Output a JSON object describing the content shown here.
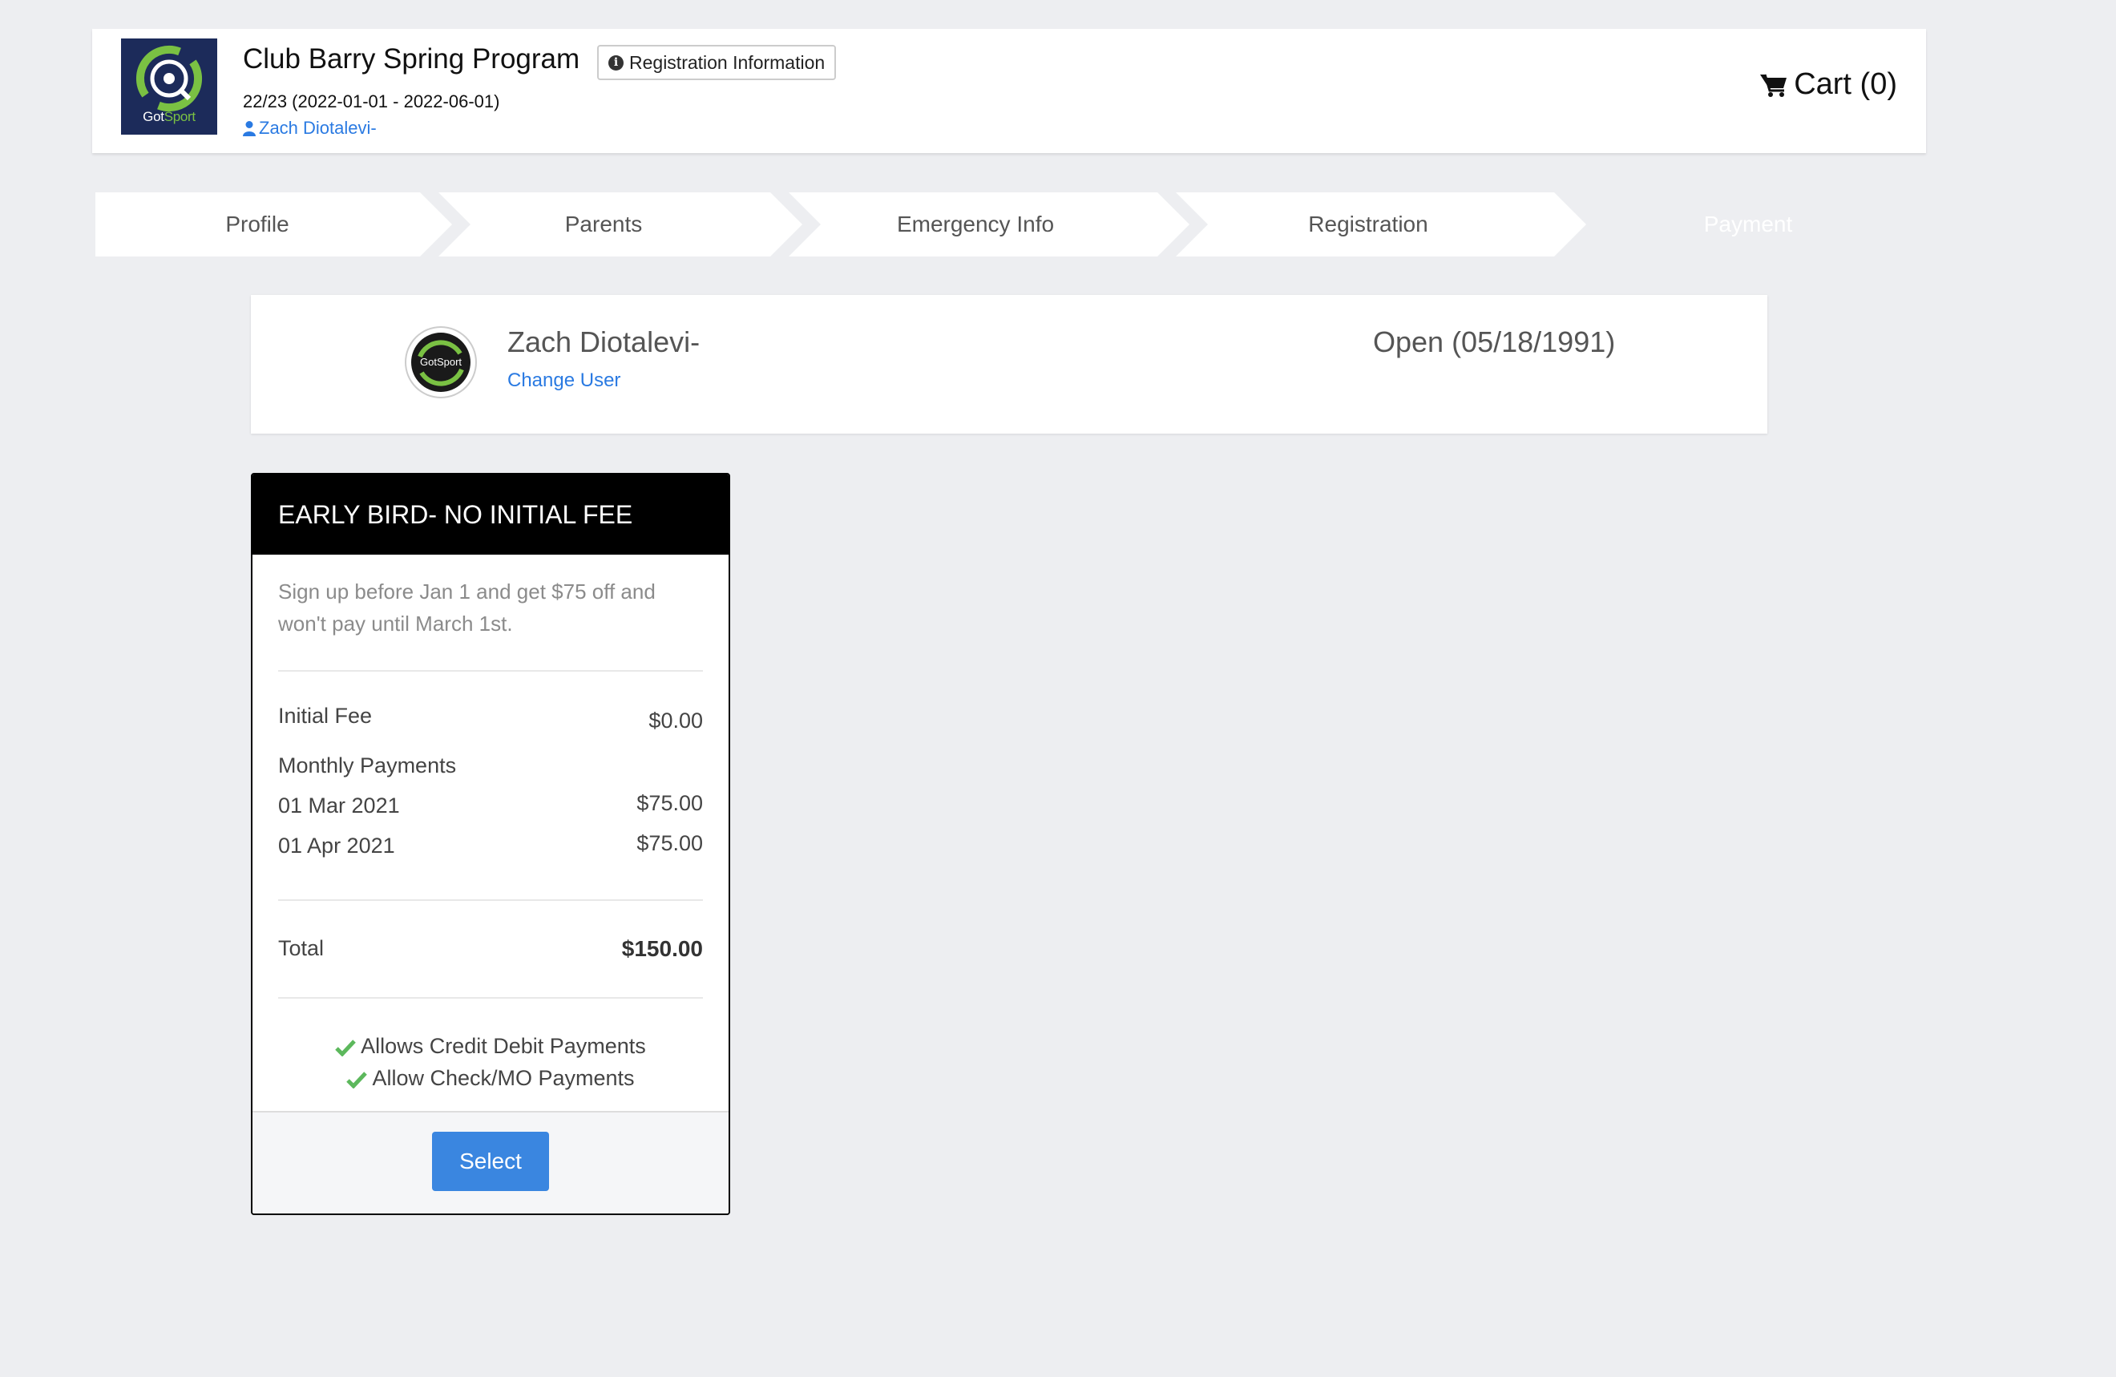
{
  "header": {
    "logo_text_got": "Got",
    "logo_text_sport": "Sport",
    "program_title": "Club Barry Spring Program",
    "registration_info_label": "Registration Information",
    "season": "22/23 (2022-01-01 - 2022-06-01)",
    "user_name": "Zach Diotalevi-",
    "cart_label": "Cart (0)"
  },
  "steps": [
    {
      "label": "Profile",
      "active": false
    },
    {
      "label": "Parents",
      "active": false
    },
    {
      "label": "Emergency Info",
      "active": false
    },
    {
      "label": "Registration",
      "active": false
    },
    {
      "label": "Payment",
      "active": true
    }
  ],
  "user_card": {
    "avatar_text": "GotSport",
    "name": "Zach Diotalevi-",
    "change_user_label": "Change User",
    "status": "Open (05/18/1991)"
  },
  "plan": {
    "title": "EARLY BIRD- NO INITIAL FEE",
    "description": "Sign up before Jan 1 and get $75 off and won't pay until March 1st.",
    "initial_fee_label": "Initial Fee",
    "initial_fee_value": "$0.00",
    "monthly_label": "Monthly Payments",
    "payments": [
      {
        "date": "01 Mar 2021",
        "amount": "$75.00"
      },
      {
        "date": "01 Apr 2021",
        "amount": "$75.00"
      }
    ],
    "total_label": "Total",
    "total_value": "$150.00",
    "options": [
      "Allows Credit Debit Payments",
      "Allow Check/MO Payments"
    ],
    "select_label": "Select"
  },
  "colors": {
    "link": "#2a7ae2",
    "check": "#5cb85c",
    "button": "#3a86e0",
    "logo_bg": "#1c2b5a",
    "logo_accent": "#7ac143"
  }
}
